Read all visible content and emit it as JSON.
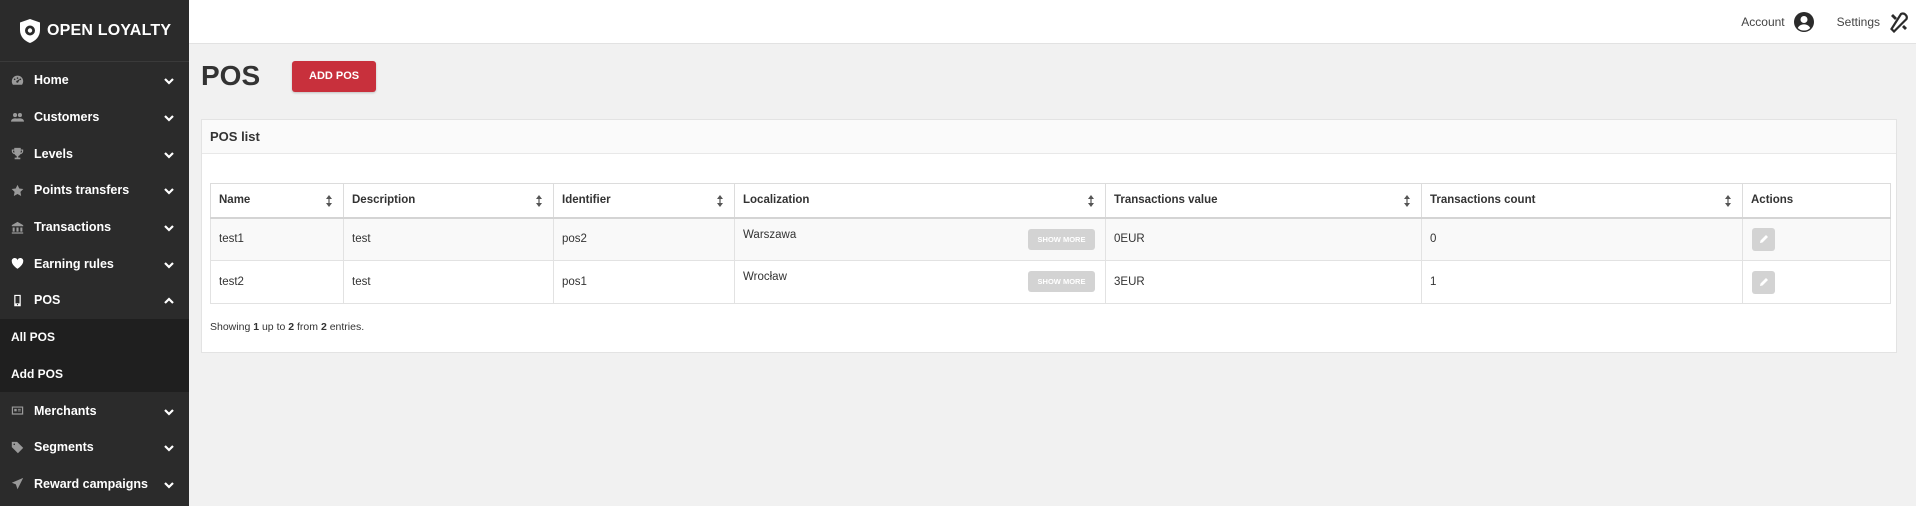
{
  "brand": {
    "name": "OPEN LOYALTY"
  },
  "sidebar": {
    "items": [
      {
        "label": "Home",
        "icon": "dashboard-icon",
        "expanded": false
      },
      {
        "label": "Customers",
        "icon": "users-icon",
        "expanded": false
      },
      {
        "label": "Levels",
        "icon": "trophy-icon",
        "expanded": false
      },
      {
        "label": "Points transfers",
        "icon": "star-icon",
        "expanded": false
      },
      {
        "label": "Transactions",
        "icon": "bank-icon",
        "expanded": false
      },
      {
        "label": "Earning rules",
        "icon": "heart-icon",
        "expanded": false
      },
      {
        "label": "POS",
        "icon": "mobile-icon",
        "expanded": true
      },
      {
        "label": "Merchants",
        "icon": "id-card-icon",
        "expanded": false
      },
      {
        "label": "Segments",
        "icon": "tag-icon",
        "expanded": false
      },
      {
        "label": "Reward campaigns",
        "icon": "send-icon",
        "expanded": false
      }
    ],
    "pos_sub": [
      "All POS",
      "Add POS"
    ]
  },
  "topbar": {
    "account": "Account",
    "settings": "Settings"
  },
  "page": {
    "title": "POS",
    "add_button": "ADD POS"
  },
  "panel": {
    "title": "POS list"
  },
  "table": {
    "headers": [
      "Name",
      "Description",
      "Identifier",
      "Localization",
      "Transactions value",
      "Transactions count",
      "Actions"
    ],
    "rows": [
      {
        "name": "test1",
        "description": "test",
        "identifier": "pos2",
        "localization": "Warszawa",
        "value": "0EUR",
        "count": "0"
      },
      {
        "name": "test2",
        "description": "test",
        "identifier": "pos1",
        "localization": "Wrocław",
        "value": "3EUR",
        "count": "1"
      }
    ],
    "show_more": "SHOW MORE"
  },
  "footer": {
    "prefix": "Showing",
    "from": "1",
    "mid1": "up to",
    "to": "2",
    "mid2": "from",
    "total": "2",
    "suffix": "entries."
  },
  "colors": {
    "sidebar": "#2b2b2b",
    "accent": "#c8303c",
    "subnav": "#1f1f1f"
  }
}
